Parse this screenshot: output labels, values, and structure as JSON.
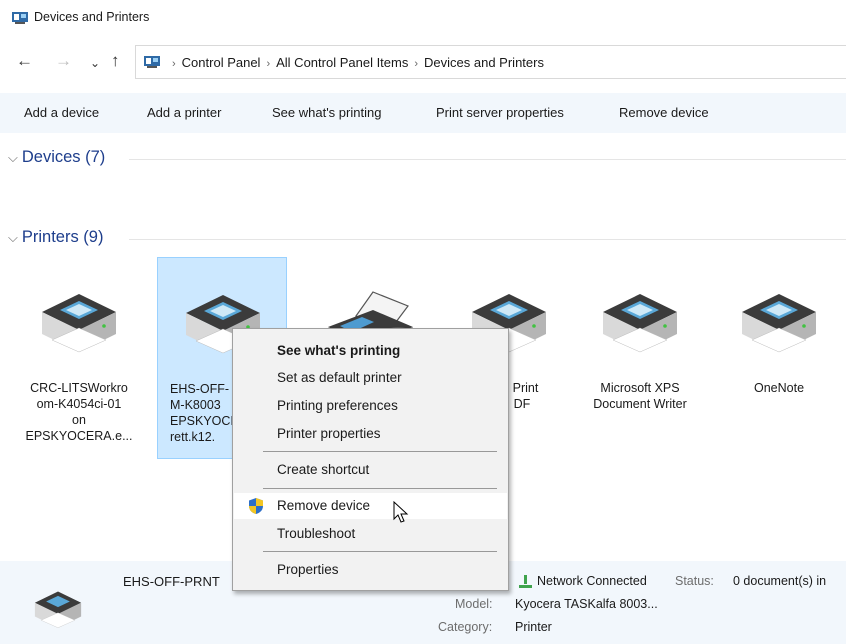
{
  "window": {
    "title": "Devices and Printers"
  },
  "nav": {
    "back_icon": "←",
    "forward_icon": "→",
    "recent_icon": "⌄",
    "up_icon": "↑",
    "breadcrumb": [
      "Control Panel",
      "All Control Panel Items",
      "Devices and Printers"
    ],
    "separator": "›"
  },
  "commands": [
    "Add a device",
    "Add a printer",
    "See what's printing",
    "Print server properties",
    "Remove device"
  ],
  "groups": {
    "devices": {
      "chevron": "⌵",
      "label": "Devices (7)"
    },
    "printers": {
      "chevron": "⌵",
      "label": "Printers (9)"
    }
  },
  "printers": [
    {
      "label": "CRC-LITSWorkro\nom-K4054ci-01\non\nEPSKYOCERA.e...",
      "icon": "printer-icon",
      "selected": false
    },
    {
      "label": "EHS-OFF-\nM-K8003\nEPSKYOCI\nrett.k12.",
      "icon": "printer-icon",
      "selected": true
    },
    {
      "label": "",
      "icon": "fax-icon",
      "selected": false
    },
    {
      "label": "t Print\nDF",
      "icon": "printer-icon",
      "selected": false
    },
    {
      "label": "Microsoft XPS\nDocument Writer",
      "icon": "printer-icon",
      "selected": false
    },
    {
      "label": "OneNote",
      "icon": "printer-icon",
      "selected": false
    }
  ],
  "details": {
    "name": "EHS-OFF-PRNT",
    "status_value": "Network Connected",
    "status_label": "Status:",
    "documents": "0 document(s) in",
    "model_label": "Model:",
    "model_value": "Kyocera TASKalfa 8003...",
    "category_label": "Category:",
    "category_value": "Printer"
  },
  "context_menu": {
    "items": [
      {
        "label": "See what's printing",
        "bold": true
      },
      {
        "label": "Set as default printer"
      },
      {
        "label": "Printing preferences"
      },
      {
        "label": "Printer properties"
      },
      {
        "label": "Create shortcut"
      },
      {
        "label": "Remove device",
        "icon": "uac-shield-icon",
        "hovered": true
      },
      {
        "label": "Troubleshoot"
      },
      {
        "label": "Properties"
      }
    ]
  },
  "colors": {
    "accent": "#1e3e8c",
    "selection": "#cce8ff",
    "bar": "#f2f7fc"
  }
}
